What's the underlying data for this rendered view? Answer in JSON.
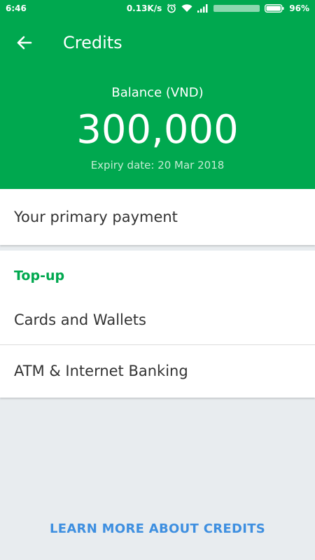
{
  "status_bar": {
    "time": "6:46",
    "network_speed": "0.13K/s",
    "battery": "96%",
    "icons": [
      "alarm-icon",
      "wifi-icon",
      "signal-icon",
      "battery-icon"
    ]
  },
  "header": {
    "back_icon": "arrow-left-icon",
    "title": "Credits",
    "balance_label": "Balance (VND)",
    "balance_amount": "300,000",
    "expiry": "Expiry date: 20 Mar 2018"
  },
  "primary_payment": {
    "label": "Your primary payment"
  },
  "topup": {
    "header": "Top-up",
    "items": [
      {
        "label": "Cards and Wallets"
      },
      {
        "label": "ATM & Internet Banking"
      }
    ]
  },
  "footer": {
    "learn_more": "LEARN MORE ABOUT CREDITS"
  },
  "colors": {
    "brand_green": "#00a84f",
    "link_blue": "#3e8fe0",
    "background": "#e8ecef"
  }
}
